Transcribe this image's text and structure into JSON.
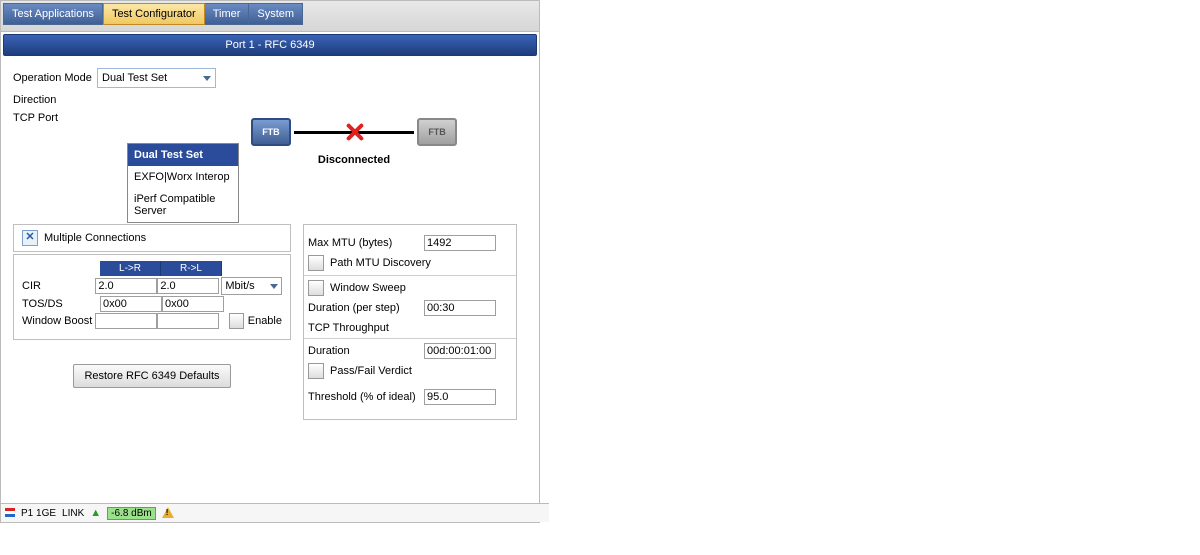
{
  "tabs": {
    "applications": "Test Applications",
    "configurator": "Test Configurator",
    "timer": "Timer",
    "system": "System"
  },
  "title": "Port 1 - RFC 6349",
  "form": {
    "operation_mode_label": "Operation Mode",
    "operation_mode_value": "Dual Test Set",
    "direction_label": "Direction",
    "tcp_port_label": "TCP Port"
  },
  "dropdown": {
    "opt1": "Dual Test Set",
    "opt2": "EXFO|Worx Interop",
    "opt3": "iPerf Compatible Server"
  },
  "diagram": {
    "node_local": "FTB",
    "node_remote": "FTB",
    "status": "Disconnected"
  },
  "left": {
    "multiple_connections": "Multiple Connections",
    "col_lr": "L->R",
    "col_rl": "R->L",
    "cir": "CIR",
    "cir_lr": "2.0",
    "cir_rl": "2.0",
    "cir_unit": "Mbit/s",
    "tos": "TOS/DS",
    "tos_lr": "0x00",
    "tos_rl": "0x00",
    "wboost": "Window Boost",
    "enable": "Enable",
    "restore": "Restore RFC 6349 Defaults"
  },
  "right": {
    "max_mtu_label": "Max MTU (bytes)",
    "max_mtu": "1492",
    "path_mtu": "Path MTU Discovery",
    "window_sweep": "Window Sweep",
    "dur_step_label": "Duration (per step)",
    "dur_step": "00:30",
    "tcp_throughput": "TCP Throughput",
    "duration_label": "Duration",
    "duration": "00d:00:01:00",
    "pass_fail": "Pass/Fail Verdict",
    "threshold_label": "Threshold (% of ideal)",
    "threshold": "95.0"
  },
  "status": {
    "port": "P1 1GE",
    "link": "LINK",
    "dbm": "-6.8 dBm"
  }
}
